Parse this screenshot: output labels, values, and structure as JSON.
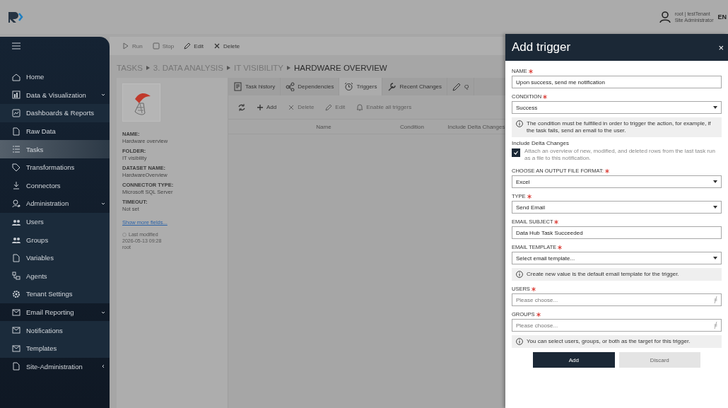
{
  "header": {
    "user": "root | testTenant",
    "role": "Site Administrator",
    "language": "EN"
  },
  "sidebar": {
    "items": [
      {
        "label": "Home",
        "selected": false
      },
      {
        "label": "Data & Visualization",
        "selected": false,
        "expanded": true,
        "children": [
          {
            "label": "Dashboards & Reports",
            "selected": false
          }
        ]
      },
      {
        "label": "Raw Data",
        "selected": false
      },
      {
        "label": "Tasks",
        "selected": true
      },
      {
        "label": "Transformations",
        "selected": false
      },
      {
        "label": "Connectors",
        "selected": false
      },
      {
        "label": "Administration",
        "selected": false,
        "expanded": true,
        "children": [
          {
            "label": "Users",
            "selected": false
          },
          {
            "label": "Groups",
            "selected": false
          },
          {
            "label": "Variables",
            "selected": false
          },
          {
            "label": "Agents",
            "selected": false
          },
          {
            "label": "Tenant Settings",
            "selected": false
          }
        ]
      },
      {
        "label": "Email Reporting",
        "selected": false,
        "expanded": true,
        "children": [
          {
            "label": "Notifications",
            "selected": false
          },
          {
            "label": "Templates",
            "selected": false
          }
        ]
      },
      {
        "label": "Site-Administration",
        "selected": false,
        "expanded": false
      }
    ]
  },
  "toolbar": [
    {
      "label": "Run",
      "disabled": true
    },
    {
      "label": "Stop",
      "disabled": true
    },
    {
      "label": "Edit",
      "disabled": false
    },
    {
      "label": "Delete",
      "disabled": false
    }
  ],
  "breadcrumb": [
    {
      "label": "TASKS",
      "current": false
    },
    {
      "label": "3. DATA ANALYSIS",
      "current": false
    },
    {
      "label": "IT VISIBILITY",
      "current": false
    },
    {
      "label": "HARDWARE OVERVIEW",
      "current": true
    }
  ],
  "details": {
    "fields": [
      {
        "label": "NAME:",
        "value": "Hardware overview"
      },
      {
        "label": "FOLDER:",
        "value": "IT visibility"
      },
      {
        "label": "DATASET NAME:",
        "value": "HardwareOverview"
      },
      {
        "label": "CONNECTOR TYPE:",
        "value": "Microsoft SQL Server"
      },
      {
        "label": "TIMEOUT:",
        "value": "Not set"
      }
    ],
    "link": "Show more fields...",
    "modified": {
      "label": "Last modified",
      "date": "2026-05-13 09:28",
      "user": "root"
    }
  },
  "tabs": [
    {
      "label": "Task history",
      "selected": false
    },
    {
      "label": "Dependencies",
      "selected": false
    },
    {
      "label": "Triggers",
      "selected": true
    },
    {
      "label": "Recent Changes",
      "selected": false
    },
    {
      "label": "Q",
      "selected": false
    }
  ],
  "triggers_toolbar": [
    {
      "label": "Add",
      "disabled": false
    },
    {
      "label": "Delete",
      "disabled": true
    },
    {
      "label": "Edit",
      "disabled": true
    },
    {
      "label": "Enable all triggers",
      "disabled": true
    }
  ],
  "table": {
    "columns": [
      "Name",
      "Condition",
      "Include Delta Changes"
    ]
  },
  "drawer": {
    "title": "Add trigger",
    "close": "×",
    "fields": [
      {
        "kind": "text",
        "label": "NAME",
        "required": true,
        "value": "Upon success, send me notification"
      },
      {
        "kind": "select",
        "label": "CONDITION",
        "required": true,
        "value": "Success"
      },
      {
        "kind": "info",
        "text": "The condition must be fulfilled in order to trigger the action, for example, if the task fails, send an email to the user."
      },
      {
        "kind": "checkbox",
        "label": "Include Delta Changes",
        "checked": true,
        "description": "Attach an overview of new, modified, and deleted rows from the last task run as a file to this notification."
      },
      {
        "kind": "select",
        "label": "CHOOSE AN OUTPUT FILE FORMAT:",
        "required": true,
        "value": "Excel"
      },
      {
        "kind": "select",
        "label": "TYPE",
        "required": true,
        "value": "Send Email"
      },
      {
        "kind": "text",
        "label": "EMAIL SUBJECT",
        "required": true,
        "value": "Data Hub Task Succeeded"
      },
      {
        "kind": "select",
        "label": "EMAIL TEMPLATE",
        "required": true,
        "value": "Select email template..."
      },
      {
        "kind": "info",
        "text": "Create new value is the default email template for the trigger."
      },
      {
        "kind": "picker",
        "label": "USERS",
        "required": true,
        "placeholder": "Please choose..."
      },
      {
        "kind": "picker",
        "label": "GROUPS",
        "required": true,
        "placeholder": "Please choose..."
      },
      {
        "kind": "info",
        "text": "You can select users, groups, or both as the target for this trigger."
      }
    ],
    "buttons": [
      {
        "label": "Add",
        "primary": true
      },
      {
        "label": "Discard",
        "primary": false
      }
    ]
  }
}
